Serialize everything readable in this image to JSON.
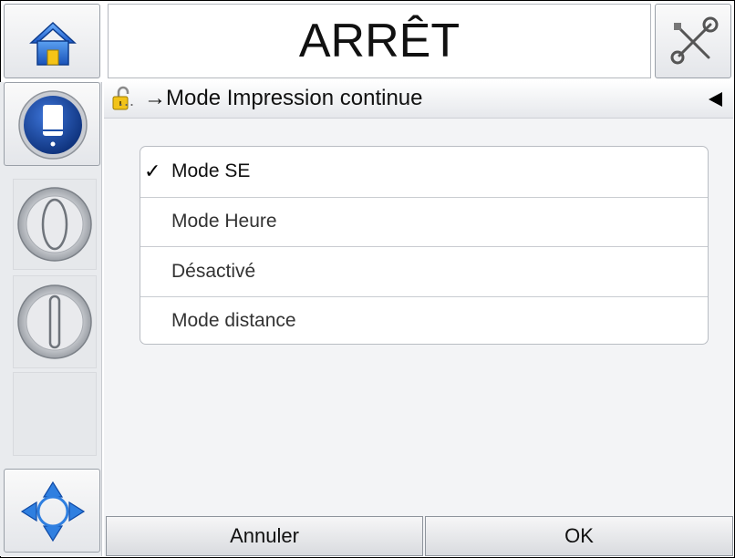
{
  "header": {
    "title": "ARRÊT"
  },
  "breadcrumb": {
    "ellipsis": "...",
    "arrow": "→",
    "path": "Mode Impression continue"
  },
  "options": [
    {
      "label": "Mode SE",
      "checked": true
    },
    {
      "label": "Mode Heure",
      "checked": false
    },
    {
      "label": "Désactivé",
      "checked": false
    },
    {
      "label": "Mode distance",
      "checked": false
    }
  ],
  "check_mark": "✓",
  "footer": {
    "cancel_label": "Annuler",
    "ok_label": "OK"
  },
  "icons": {
    "home": "home-icon",
    "tools": "tools-icon",
    "ink": "ink-cartridge-icon",
    "jet_start": "jet-start-icon",
    "jet_stop": "jet-stop-icon",
    "nav": "navigation-arrows-icon",
    "lock": "padlock-open-icon",
    "back": "back-arrow-icon"
  },
  "colors": {
    "accent": "#1e4fa8",
    "background": "#f3f4f6"
  }
}
